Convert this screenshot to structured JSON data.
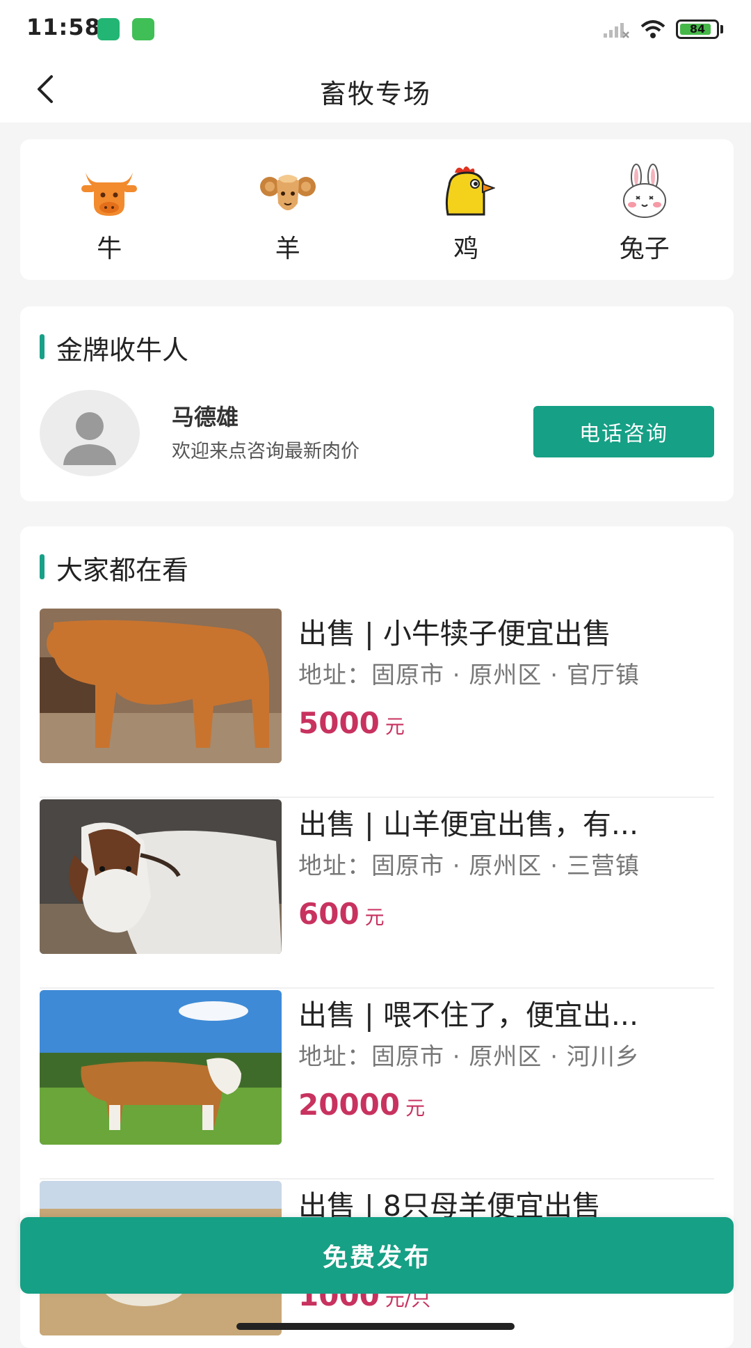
{
  "status_bar": {
    "time": "11:58",
    "battery": "84"
  },
  "header": {
    "title": "畜牧专场"
  },
  "categories": [
    {
      "label": "牛",
      "icon": "cow-icon"
    },
    {
      "label": "羊",
      "icon": "sheep-icon"
    },
    {
      "label": "鸡",
      "icon": "chicken-icon"
    },
    {
      "label": "兔子",
      "icon": "rabbit-icon"
    }
  ],
  "buyer_section": {
    "title": "金牌收牛人",
    "name": "马德雄",
    "desc": "欢迎来点咨询最新肉价",
    "button_label": "电话咨询"
  },
  "feed": {
    "title": "大家都在看",
    "items": [
      {
        "title": "出售 | 小牛犊子便宜出售",
        "address": "地址：固原市 · 原州区 · 官厅镇",
        "price": "5000",
        "unit": "元"
      },
      {
        "title": "出售 | 山羊便宜出售，有...",
        "address": "地址：固原市 · 原州区 · 三营镇",
        "price": "600",
        "unit": "元"
      },
      {
        "title": "出售 | 喂不住了，便宜出...",
        "address": "地址：固原市 · 原州区 · 河川乡",
        "price": "20000",
        "unit": "元"
      },
      {
        "title": "出售 | 8只母羊便宜出售",
        "address": "",
        "price": "1000",
        "unit": "元/只"
      }
    ]
  },
  "publish_button": "免费发布",
  "colors": {
    "accent": "#16a085",
    "price": "#c8325f"
  }
}
